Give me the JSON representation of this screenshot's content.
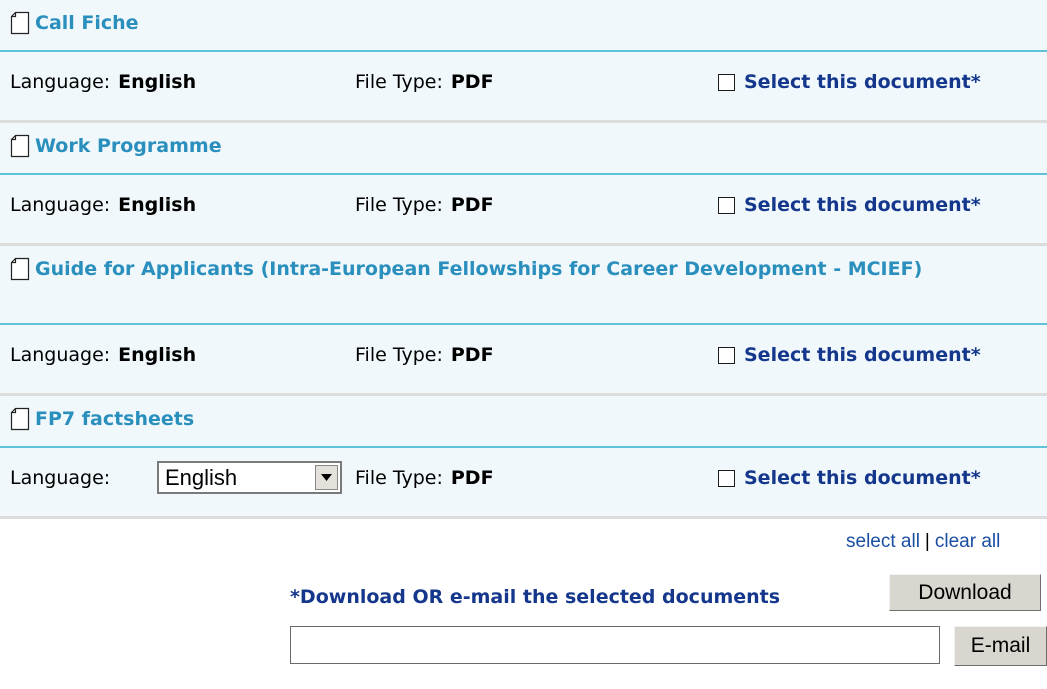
{
  "labels": {
    "language": "Language:",
    "file_type": "File Type:",
    "select_document": "Select this document*"
  },
  "documents": [
    {
      "title": "Call Fiche",
      "language": "English",
      "file_type": "PDF"
    },
    {
      "title": "Work Programme",
      "language": "English",
      "file_type": "PDF"
    },
    {
      "title": "Guide for Applicants (Intra-European Fellowships for Career Development - MCIEF)",
      "language": "English",
      "file_type": "PDF"
    },
    {
      "title": "FP7 factsheets",
      "language": "English",
      "file_type": "PDF"
    }
  ],
  "selection": {
    "select_all": "select all",
    "separator": "|",
    "clear_all": "clear all"
  },
  "actions": {
    "download_prompt": "*Download OR e-mail the selected documents",
    "download_button": "Download",
    "email_button": "E-mail",
    "email_value": ""
  },
  "colors": {
    "title_link": "#2a8fbd",
    "dark_link": "#14378c",
    "row_background": "#f0f8fc",
    "separator_line": "#5fc3d8"
  },
  "icons": {
    "document": "page-icon",
    "dropdown": "chevron-down-icon"
  }
}
